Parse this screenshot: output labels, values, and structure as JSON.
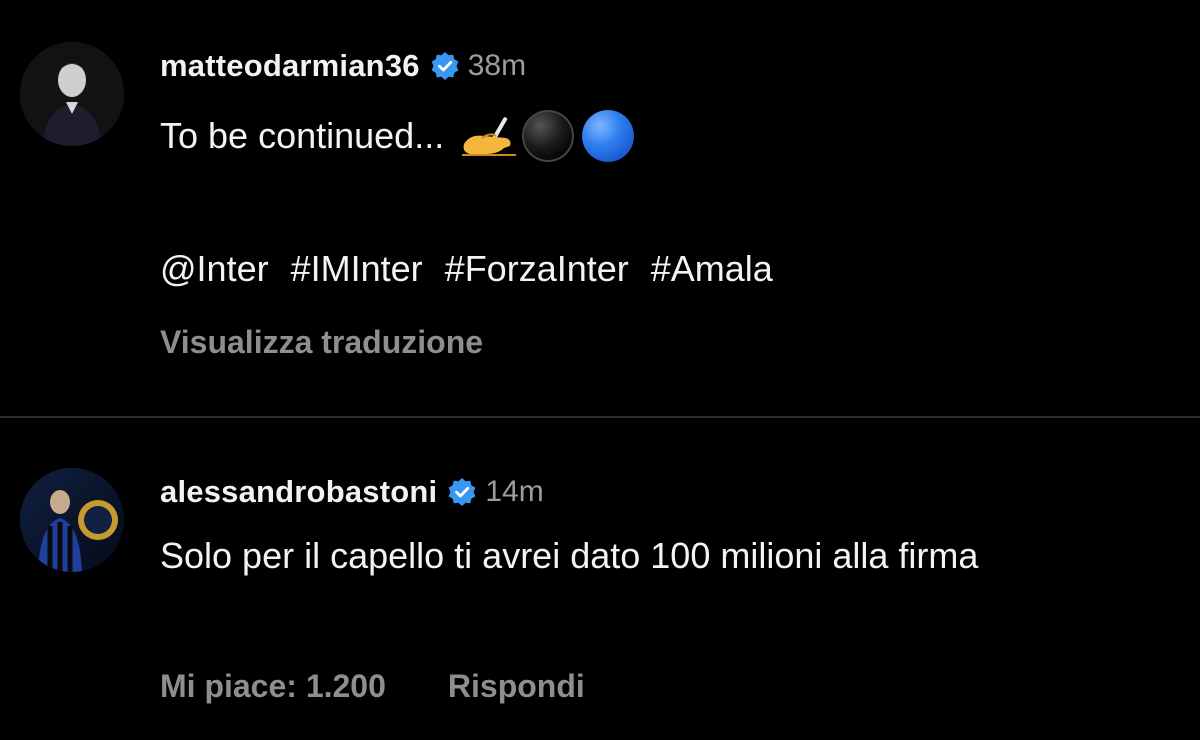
{
  "post": {
    "author": {
      "username": "matteodarmian36",
      "verified": true,
      "time": "38m"
    },
    "caption": "To be continued...",
    "emojis": [
      "writing-hand",
      "black-circle",
      "blue-circle"
    ],
    "tags": [
      "@Inter",
      "#IMInter",
      "#ForzaInter",
      "#Amala"
    ],
    "see_translation": "Visualizza traduzione"
  },
  "comment": {
    "author": {
      "username": "alessandrobastoni",
      "verified": true,
      "time": "14m"
    },
    "text": "Solo per il capello ti avrei dato 100 milioni alla firma",
    "likes_label": "Mi piace: 1.200",
    "reply_label": "Rispondi"
  },
  "colors": {
    "background": "#000000",
    "verified_badge": "#3897f0",
    "muted_text": "#8e8e8e",
    "divider": "#2b2b2b"
  }
}
